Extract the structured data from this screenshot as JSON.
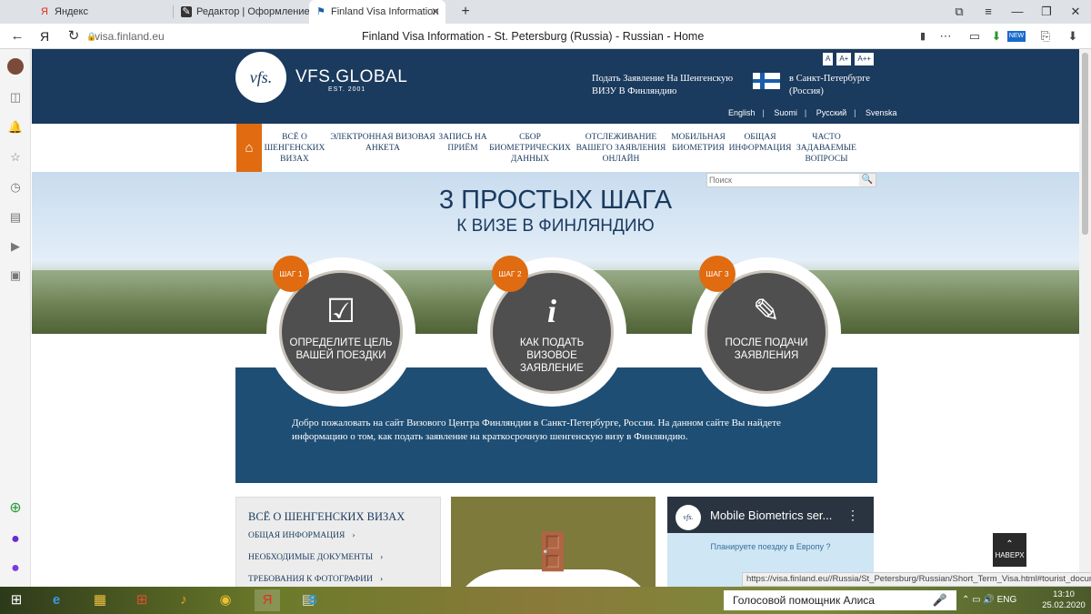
{
  "browser": {
    "tabs": [
      {
        "icon": "Я",
        "label": "Яндекс",
        "close": "✕"
      },
      {
        "icon": "✎",
        "label": "Редактор | Оформление ш",
        "close": "✕"
      },
      {
        "icon": "⚑",
        "label": "Finland Visa Information",
        "close": "✕"
      }
    ],
    "new_tab": "+",
    "window_buttons": [
      "⧉",
      "≡",
      "—",
      "❐",
      "✕"
    ],
    "back": "←",
    "yandex": "Я",
    "reload": "↻",
    "lock": "🔒",
    "url": "visa.finland.eu",
    "page_title": "Finland Visa Information - St. Petersburg (Russia) - Russian - Home",
    "toolbar_icons": [
      "▭",
      "⬇",
      "NEW",
      "⎘",
      "⬇"
    ],
    "bookmark": "▮",
    "menu": "⋯"
  },
  "sidebar": {
    "icons": [
      "●",
      "◫",
      "🔔",
      "☆",
      "◷",
      "▤",
      "▶",
      "▣",
      "⊕",
      "●",
      "●"
    ]
  },
  "header": {
    "logo_mark": "vfs.",
    "logo_text": "VFS.GLOBAL",
    "logo_est": "EST. 2001",
    "font_sizes": [
      "A",
      "A+",
      "A++"
    ],
    "apply_text": "Подать Заявление На Шенгенскую ВИЗУ В Финляндию",
    "city_text": "в Санкт-Петербурге (Россия)",
    "languages": [
      "English",
      "Suomi",
      "Русский",
      "Svenska"
    ]
  },
  "menu": {
    "home_icon": "⌂",
    "items": [
      "ВСЁ О ШЕНГЕНСКИХ ВИЗАХ",
      "ЭЛЕКТРОННАЯ ВИЗОВАЯ АНКЕТА",
      "ЗАПИСЬ НА ПРИЁМ",
      "СБОР БИОМЕТРИЧЕСКИХ ДАННЫХ",
      "ОТСЛЕЖИВАНИЕ ВАШЕГО ЗАЯВЛЕНИЯ ОНЛАЙН",
      "МОБИЛЬНАЯ БИОМЕТРИЯ",
      "ОБЩАЯ ИНФОРМАЦИЯ",
      "ЧАСТО ЗАДАВАЕМЫЕ ВОПРОСЫ"
    ]
  },
  "search": {
    "placeholder": "Поиск",
    "icon": "🔍"
  },
  "hero": {
    "title": "3 ПРОСТЫХ ШАГА",
    "subtitle": "К ВИЗЕ В ФИНЛЯНДИЮ"
  },
  "steps": [
    {
      "badge": "ШАГ 1",
      "glyph": "☑",
      "label": "ОПРЕДЕЛИТЕ ЦЕЛЬ ВАШЕЙ ПОЕЗДКИ"
    },
    {
      "badge": "ШАГ 2",
      "glyph": "i",
      "label": "КАК ПОДАТЬ ВИЗОВОЕ ЗАЯВЛЕНИЕ"
    },
    {
      "badge": "ШАГ 3",
      "glyph": "✎",
      "label": "ПОСЛЕ ПОДАЧИ ЗАЯВЛЕНИЯ"
    }
  ],
  "welcome": "Добро пожаловать на сайт Визового Центра Финляндии в Санкт-Петербурге, Россия. На данном сайте Вы найдете информацию о том, как подать заявление на краткосрочную шенгенскую визу в Финляндию.",
  "infobox": {
    "title": "ВСЁ О ШЕНГЕНСКИХ ВИЗАХ",
    "links": [
      "ОБЩАЯ ИНФОРМАЦИЯ",
      "НЕОБХОДИМЫЕ ДОКУМЕНТЫ",
      "ТРЕБОВАНИЯ К ФОТОГРАФИИ"
    ],
    "chevron": "›"
  },
  "video": {
    "logo": "vfs.",
    "title": "Mobile Biometrics ser...",
    "menu": "⋮",
    "subtitle": "Планируете поездку в Европу ?"
  },
  "to_top": {
    "arrow": "⌃",
    "label": "НАВЕРХ"
  },
  "status_url": "https://visa.finland.eu//Russia/St_Petersburg/Russian/Short_Term_Visa.html#tourist_documents",
  "taskbar": {
    "start": "⊞",
    "apps": [
      "e",
      "▦",
      "⊞",
      "♪",
      "◉",
      "Я",
      "▤",
      "S"
    ],
    "assistant": "Голосовой помощник Алиса",
    "mic": "🎤",
    "tray": "⌃  ▭  🔊  ENG",
    "time": "13:10",
    "date": "25.02.2020"
  }
}
